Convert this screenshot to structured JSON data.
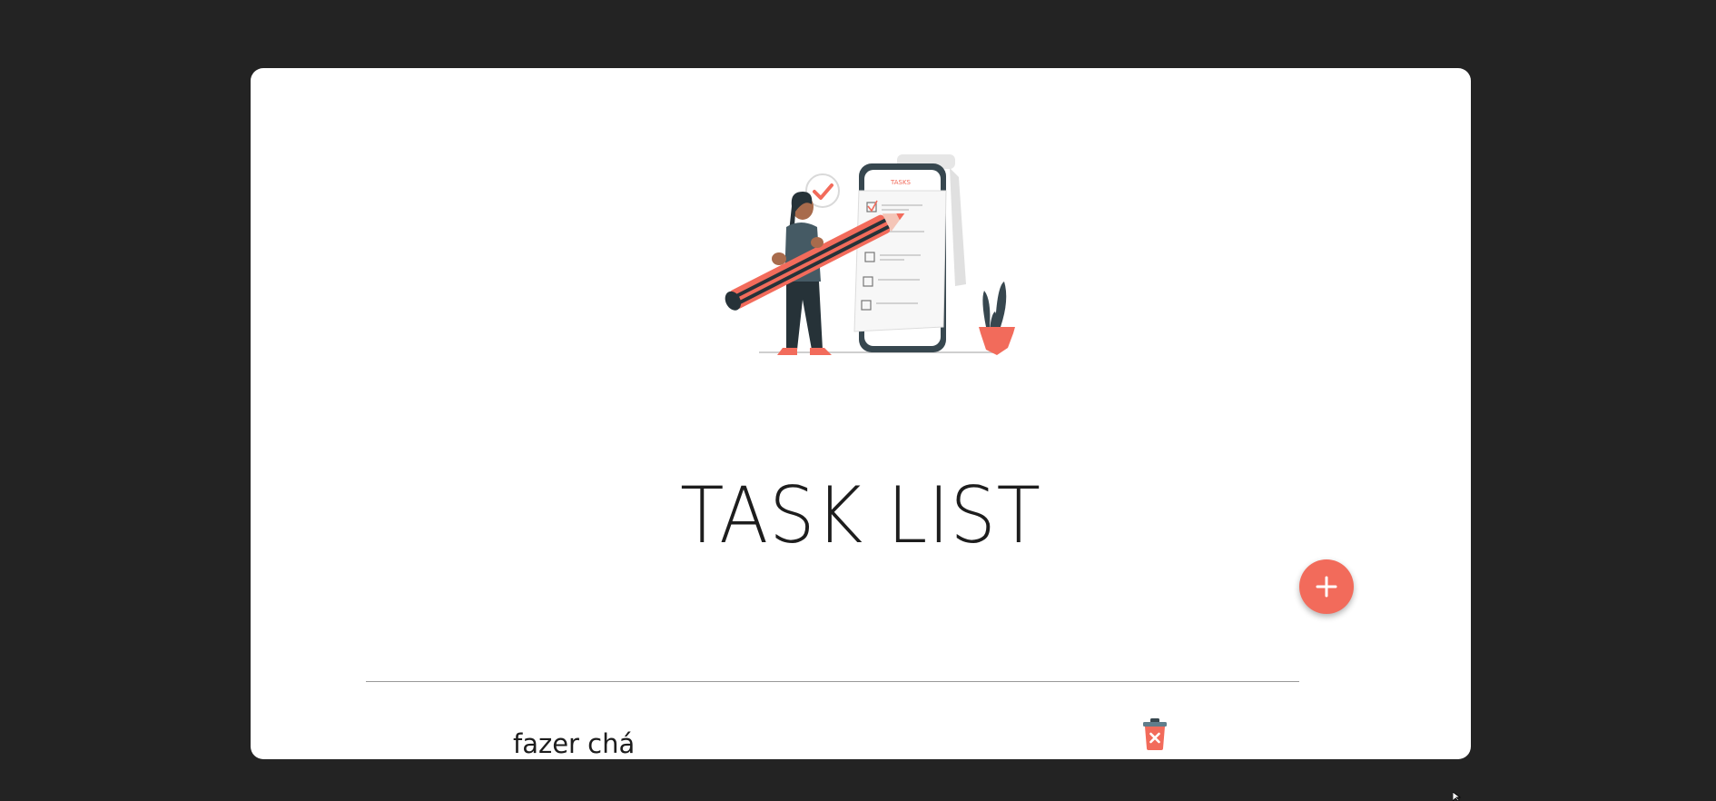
{
  "app": {
    "title": "TASK LIST"
  },
  "input": {
    "value": "",
    "placeholder": ""
  },
  "add_button": {
    "icon": "plus-icon"
  },
  "tasks": [
    {
      "text": "fazer chá",
      "delete_icon": "trash-icon"
    }
  ],
  "colors": {
    "background": "#232323",
    "card": "#ffffff",
    "accent": "#f26b5b",
    "dark": "#37474f",
    "text": "#1d1d1d"
  },
  "illustration": {
    "description_icon": "task-illustration-icon",
    "phone_header": "TASKS"
  }
}
